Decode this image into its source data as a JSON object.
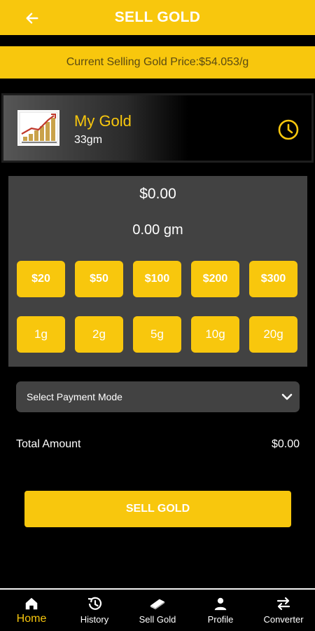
{
  "appbar": {
    "title": "SELL GOLD"
  },
  "price": {
    "text": "Current Selling Gold Price:$54.053/g"
  },
  "holdings": {
    "title": "My Gold",
    "weight": "33gm"
  },
  "calculator": {
    "amount_usd": "$0.00",
    "amount_gm": "0.00  gm",
    "usd_presets": [
      "$20",
      "$50",
      "$100",
      "$200",
      "$300"
    ],
    "gram_presets": [
      "1g",
      "2g",
      "5g",
      "10g",
      "20g"
    ]
  },
  "payment": {
    "placeholder": "Select Payment Mode"
  },
  "total": {
    "label": "Total Amount",
    "value": "$0.00"
  },
  "actions": {
    "sell_label": "SELL GOLD"
  },
  "bottom_nav": {
    "items": [
      {
        "label": "Home",
        "icon": "home-icon",
        "active": true
      },
      {
        "label": "History",
        "icon": "history-icon",
        "active": false
      },
      {
        "label": "Sell Gold",
        "icon": "gold-bar-icon",
        "active": false
      },
      {
        "label": "Profile",
        "icon": "person-icon",
        "active": false
      },
      {
        "label": "Converter",
        "icon": "swap-arrows-icon",
        "active": false
      }
    ]
  },
  "colors": {
    "accent": "#f8c70d",
    "background": "#000000",
    "panel": "#424242",
    "price_text": "#5a4a12"
  }
}
